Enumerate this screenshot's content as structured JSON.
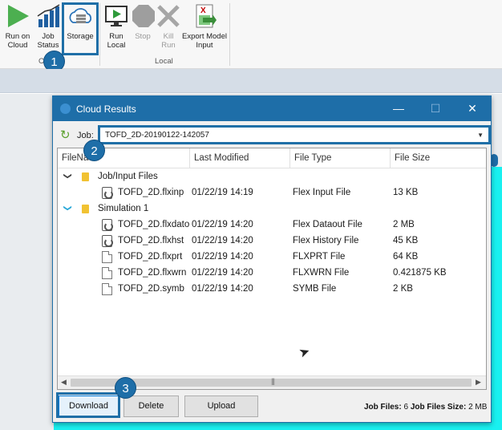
{
  "ribbon": {
    "buttons": [
      {
        "label": "Run on Cloud",
        "icon": "play-icon"
      },
      {
        "label": "Job Status",
        "icon": "bar-chart-icon"
      },
      {
        "label": "Storage",
        "icon": "cloud-storage-icon"
      },
      {
        "label": "Run Local",
        "icon": "monitor-play-icon"
      },
      {
        "label": "Stop",
        "icon": "stop-icon"
      },
      {
        "label": "Kill Run",
        "icon": "x-icon"
      },
      {
        "label": "Export Model Input",
        "icon": "excel-export-icon"
      }
    ],
    "groups": {
      "cloud_partial": "C",
      "local": "Local"
    }
  },
  "callouts": [
    "1",
    "2",
    "3"
  ],
  "dialog": {
    "title": "Cloud Results",
    "job_label": "Job:",
    "job_value": "TOFD_2D-20190122-142057",
    "columns": [
      "FileNa",
      "Last Modified",
      "File Type",
      "File Size"
    ],
    "tree": [
      {
        "kind": "folder",
        "name": "Job/Input Files",
        "expanded": true,
        "chevron": "❯"
      },
      {
        "kind": "file",
        "name": "TOFD_2D.flxinp",
        "modified": "01/22/19 14:19",
        "type": "Flex Input File",
        "size": "13 KB",
        "icon": "flex-file-icon"
      },
      {
        "kind": "folder",
        "name": "Simulation 1",
        "expanded": true,
        "chevron": "❯"
      },
      {
        "kind": "file",
        "name": "TOFD_2D.flxdato",
        "modified": "01/22/19 14:20",
        "type": "Flex Dataout File",
        "size": "2 MB",
        "icon": "flex-file-icon"
      },
      {
        "kind": "file",
        "name": "TOFD_2D.flxhst",
        "modified": "01/22/19 14:20",
        "type": "Flex History File",
        "size": "45 KB",
        "icon": "flex-file-icon"
      },
      {
        "kind": "file",
        "name": "TOFD_2D.flxprt",
        "modified": "01/22/19 14:20",
        "type": "FLXPRT File",
        "size": "64 KB",
        "icon": "document-icon"
      },
      {
        "kind": "file",
        "name": "TOFD_2D.flxwrn",
        "modified": "01/22/19 14:20",
        "type": "FLXWRN File",
        "size": "0.421875 KB",
        "icon": "document-icon"
      },
      {
        "kind": "file",
        "name": "TOFD_2D.symb",
        "modified": "01/22/19 14:20",
        "type": "SYMB File",
        "size": "2 KB",
        "icon": "document-icon"
      }
    ],
    "buttons": {
      "download": "Download",
      "delete": "Delete",
      "upload": "Upload"
    },
    "summary": {
      "job_files_label": "Job Files:",
      "job_files_value": "6",
      "size_label": "Job Files Size:",
      "size_value": "2 MB"
    }
  },
  "colors": {
    "accent": "#1e6ea8",
    "callout": "#1e6ea8",
    "highlight": "#1f6fa7"
  }
}
